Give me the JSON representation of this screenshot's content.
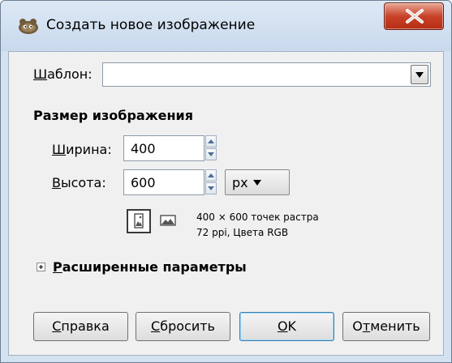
{
  "window": {
    "title": "Создать новое изображение",
    "app_icon": "gimp-wilber-icon",
    "close_icon": "close-icon"
  },
  "template": {
    "label_mnemonic": "Ш",
    "label_rest": "аблон:",
    "value": ""
  },
  "image_size": {
    "section_title": "Размер изображения",
    "width_label_mnemonic": "Ш",
    "width_label_rest": "ирина:",
    "width_value": "400",
    "height_label_mnemonic": "В",
    "height_label_rest": "ысота:",
    "height_value": "600",
    "unit": "px",
    "orientation_portrait_icon": "portrait-orientation-icon",
    "orientation_landscape_icon": "landscape-orientation-icon",
    "info_line1": "400 × 600 точек растра",
    "info_line2": "72 ppi, Цвета RGB"
  },
  "advanced": {
    "label_mnemonic": "Р",
    "label_rest": "асширенные параметры",
    "expander_icon": "expand-plus-icon"
  },
  "buttons": {
    "help_mnemonic": "С",
    "help_rest": "правка",
    "reset_mnemonic": "С",
    "reset_rest": "бросить",
    "ok_mnemonic": "О",
    "ok_rest": "K",
    "cancel_pre": "О",
    "cancel_mnemonic": "т",
    "cancel_rest": "менить"
  },
  "colors": {
    "titlebar": "#d3e1f1",
    "client_bg": "#f0f0f0",
    "close_red": "#c9432a",
    "default_button_border": "#3c7fb1"
  }
}
